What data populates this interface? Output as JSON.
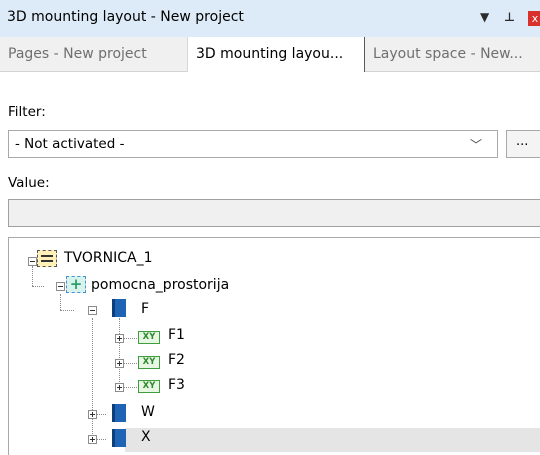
{
  "window": {
    "title": "3D mounting layout - New project",
    "menu_icon": "triangle-down-icon",
    "pin_icon": "pin-icon",
    "close_glyph": "x"
  },
  "tabs": [
    {
      "label": "Pages - New project",
      "active": false
    },
    {
      "label": "3D mounting layou...",
      "active": true
    },
    {
      "label": "Layout space - New...",
      "active": false
    }
  ],
  "filter": {
    "label": "Filter:",
    "selected": "- Not activated -",
    "more_button": "..."
  },
  "value": {
    "label": "Value:",
    "text": ""
  },
  "tree": {
    "root": {
      "label": "TVORNICA_1",
      "icon": "plant-icon",
      "expanded": true
    },
    "location": {
      "label": "pomocna_prostorija",
      "icon": "location-icon",
      "expanded": true
    },
    "items": [
      {
        "label": "F",
        "icon": "book-icon",
        "expanded": true,
        "children": [
          {
            "label": "F1",
            "icon": "xy-icon",
            "badge": "XY"
          },
          {
            "label": "F2",
            "icon": "xy-icon",
            "badge": "XY"
          },
          {
            "label": "F3",
            "icon": "xy-icon",
            "badge": "XY"
          }
        ]
      },
      {
        "label": "W",
        "icon": "book-icon",
        "expanded": false
      },
      {
        "label": "X",
        "icon": "book-icon",
        "expanded": false,
        "selected": true
      }
    ]
  },
  "colors": {
    "titlebar": "#ddeaf7",
    "close": "#d9302c",
    "selection": "#e5e5e5",
    "book": "#1f63b4",
    "xy": "#3e9e3e"
  }
}
